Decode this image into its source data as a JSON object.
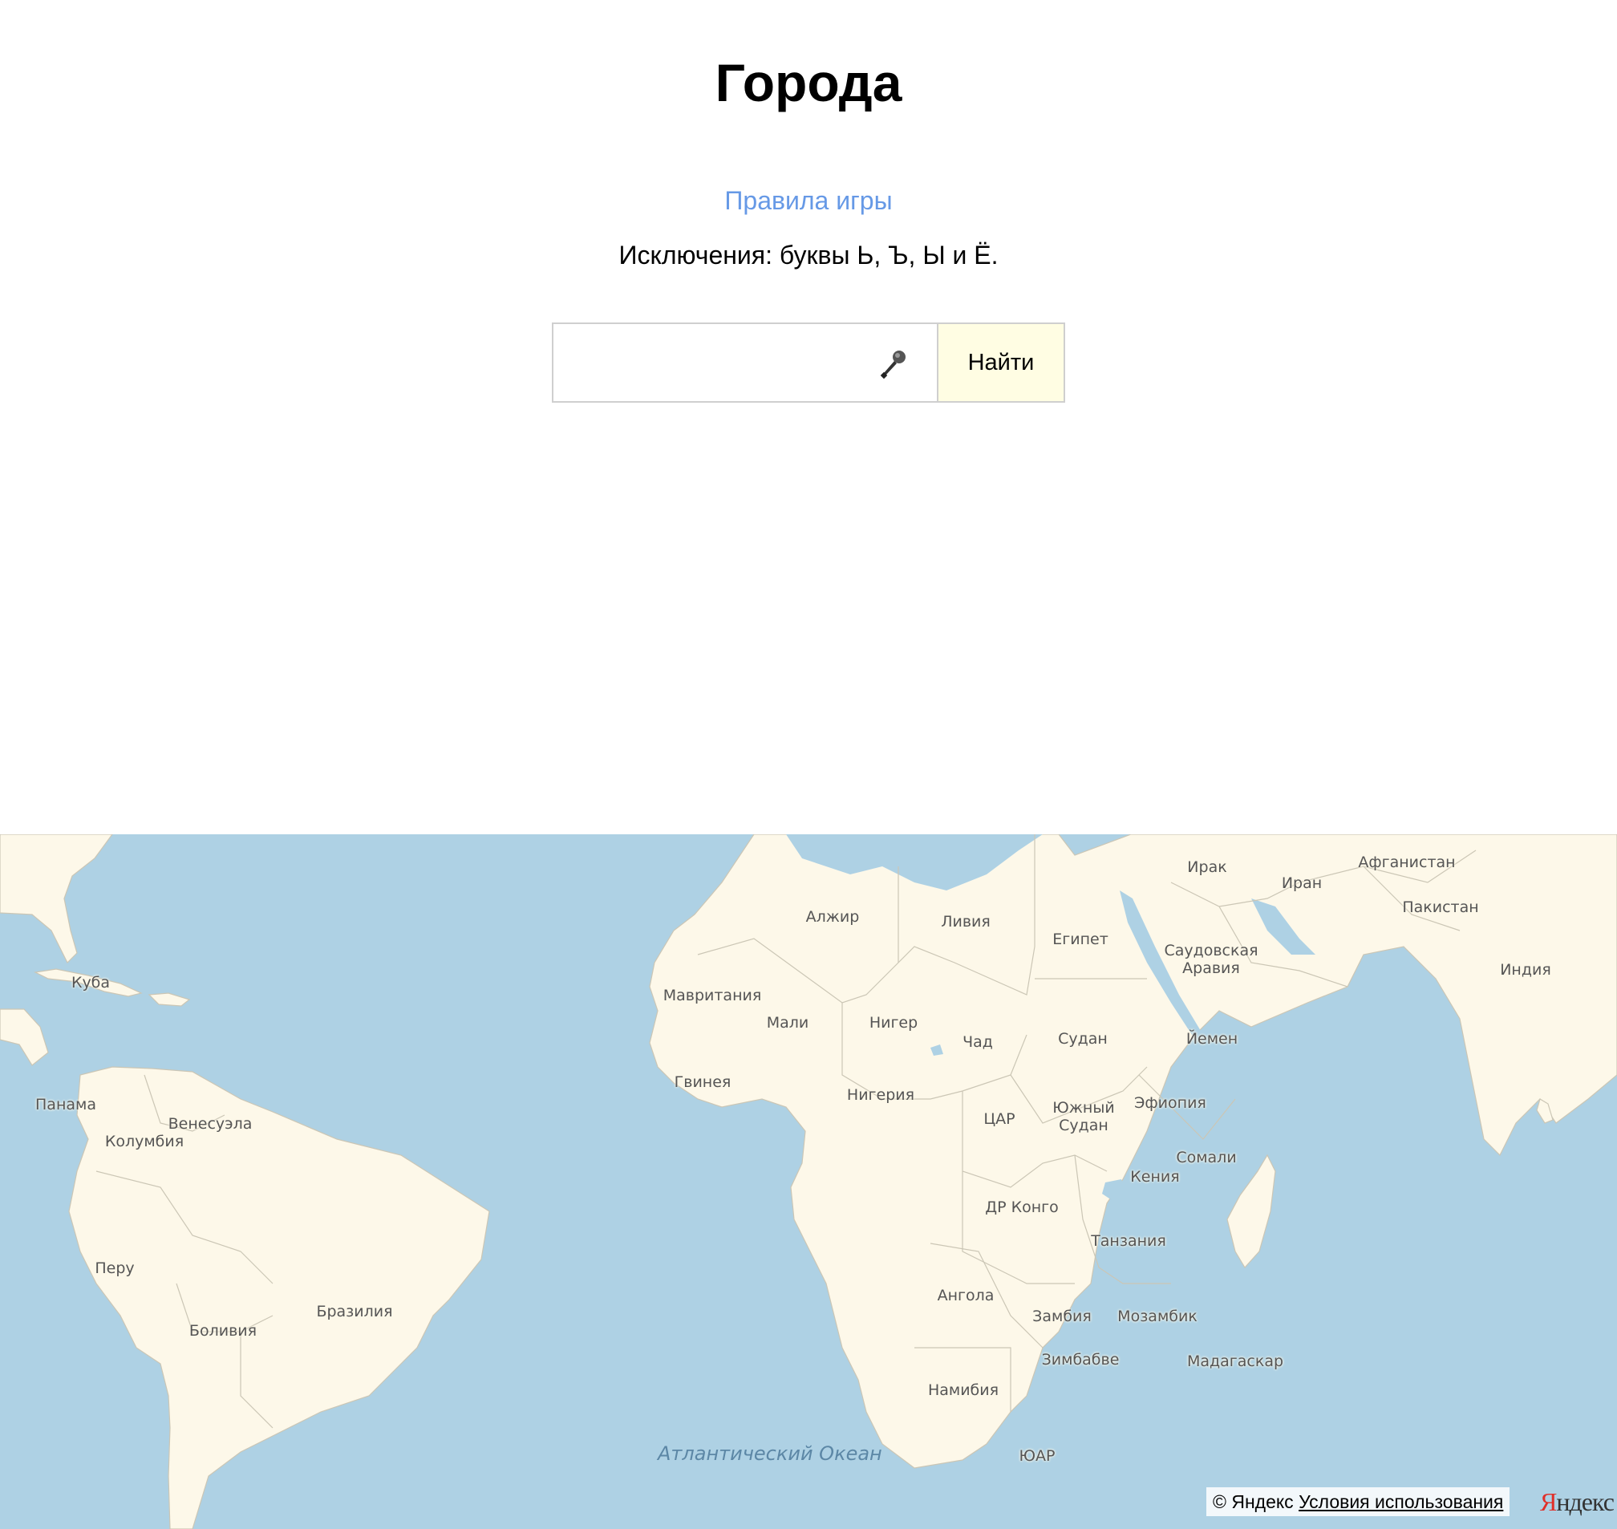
{
  "page": {
    "title": "Города",
    "rules_link": "Правила игры",
    "exceptions": "Исключения: буквы Ь, Ъ, Ы и Ё."
  },
  "search": {
    "input_value": "",
    "placeholder": "",
    "button_label": "Найти",
    "mic_icon": "microphone-icon"
  },
  "map": {
    "colors": {
      "water": "#aed1e4",
      "land": "#fdf8e9",
      "border": "#cbc6b5"
    },
    "labels": {
      "cuba": "Куба",
      "panama": "Панама",
      "venezuela": "Венесуэла",
      "colombia": "Колумбия",
      "peru": "Перу",
      "brazil": "Бразилия",
      "bolivia": "Боливия",
      "algeria": "Алжир",
      "libya": "Ливия",
      "egypt": "Египет",
      "mauritania": "Мавритания",
      "mali": "Мали",
      "niger": "Нигер",
      "chad": "Чад",
      "sudan": "Судан",
      "guinea": "Гвинея",
      "nigeria": "Нигерия",
      "car": "ЦАР",
      "south_sudan": "Южный Судан",
      "ethiopia": "Эфиопия",
      "somalia": "Сомали",
      "kenya": "Кения",
      "drc": "ДР Конго",
      "tanzania": "Танзания",
      "angola": "Ангола",
      "zambia": "Замбия",
      "mozambique": "Мозамбик",
      "madagascar": "Мадагаскар",
      "zimbabwe": "Зимбабве",
      "namibia": "Намибия",
      "rsa": "ЮАР",
      "iraq": "Ирак",
      "iran": "Иран",
      "afghanistan": "Афганистан",
      "pakistan": "Пакистан",
      "saudi_arabia": "Саудовская Аравия",
      "yemen": "Йемен",
      "india": "Индия",
      "atlantic": "Атлантический Океан"
    },
    "copyright": {
      "text": "© Яндекс",
      "terms": "Условия использования"
    },
    "logo_first_letter": "Я",
    "logo_rest": "ндекс"
  }
}
